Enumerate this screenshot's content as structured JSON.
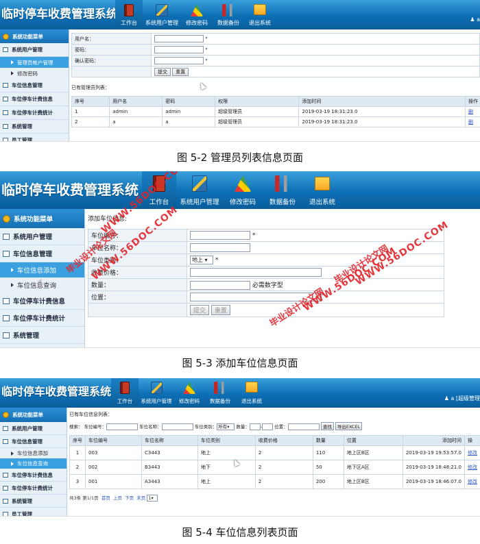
{
  "app": {
    "title": "临时停车收费管理系统",
    "nav": [
      "工作台",
      "系统用户管理",
      "修改密码",
      "数据备份",
      "退出系统"
    ]
  },
  "sidebar": {
    "head": "系统功能菜单",
    "groups": [
      "系统用户管理",
      "车位信息管理",
      "车位停车计费信息",
      "车位停车计费统计",
      "系统管理",
      "员工管理"
    ],
    "user_subs": [
      "管理员帐户管理",
      "修改密码"
    ],
    "slot_subs": [
      "车位信息添加",
      "车位信息查询"
    ]
  },
  "shot1": {
    "user_tag": "a",
    "form": {
      "username_label": "用户名：",
      "password_label": "密码：",
      "confirm_label": "确认密码：",
      "req": "*",
      "submit": "提交",
      "reset": "重置"
    },
    "list_title": "已有管理员列表：",
    "columns": [
      "序号",
      "用户名",
      "密码",
      "权限",
      "添加时间",
      "操作"
    ],
    "rows": [
      [
        "1",
        "admin",
        "admin",
        "超级管理员",
        "2019-03-19 18:31:23.0",
        "删"
      ],
      [
        "2",
        "a",
        "a",
        "超级管理员",
        "2019-03-19 18:31:23.0",
        "删"
      ]
    ]
  },
  "shot2": {
    "form_title": "添加车位信息:",
    "slot_no_label": "车位编号：",
    "slot_name_label": "车位名称：",
    "type_label": "车位类别：",
    "type_value": "地上",
    "price_label": "收费价格：",
    "qty_label": "数量：",
    "qty_hint": "必需数字型",
    "pos_label": "位置：",
    "req": "*",
    "submit": "提交",
    "reset": "重置"
  },
  "shot3": {
    "user_tag": "a [超级管理",
    "list_title": "已有车位信息列表：",
    "search": {
      "label": "搜索：",
      "no": "车位编号：",
      "name": "车位名称：",
      "type": "车位类别：",
      "type_value": "所有",
      "qty": "数量：",
      "pos": "位置：",
      "find": "查找",
      "export": "导出EXCEL"
    },
    "columns": [
      "序号",
      "车位编号",
      "车位名称",
      "车位类别",
      "收费价格",
      "数量",
      "位置",
      "添加时间",
      "操"
    ],
    "rows": [
      [
        "1",
        "003",
        "C3443",
        "地上",
        "2",
        "110",
        "地上区B区",
        "2019-03-19 19:53:57.0",
        "修改"
      ],
      [
        "2",
        "002",
        "B3443",
        "地下",
        "2",
        "50",
        "地下区A区",
        "2019-03-19 18:48:21.0",
        "修改"
      ],
      [
        "3",
        "001",
        "A3443",
        "地上",
        "2",
        "200",
        "地上区B区",
        "2019-03-19 18:46:07.0",
        "修改"
      ]
    ],
    "pager": [
      "共3条",
      "第1/1页",
      "首页",
      "上页",
      "下页",
      "末页",
      "1"
    ]
  },
  "captions": [
    "图 5-2 管理员列表信息页面",
    "图 5-3 添加车位信息页面",
    "图 5-4 车位信息列表页面"
  ],
  "watermarks": [
    "WWW.56DOC.COM",
    "毕业设计论文网",
    "WWW.56DOC.COM",
    "毕业设计论文网",
    "WWW.56DOC.COM",
    "毕业设计论文网",
    "WWW.56DOC.COM"
  ]
}
